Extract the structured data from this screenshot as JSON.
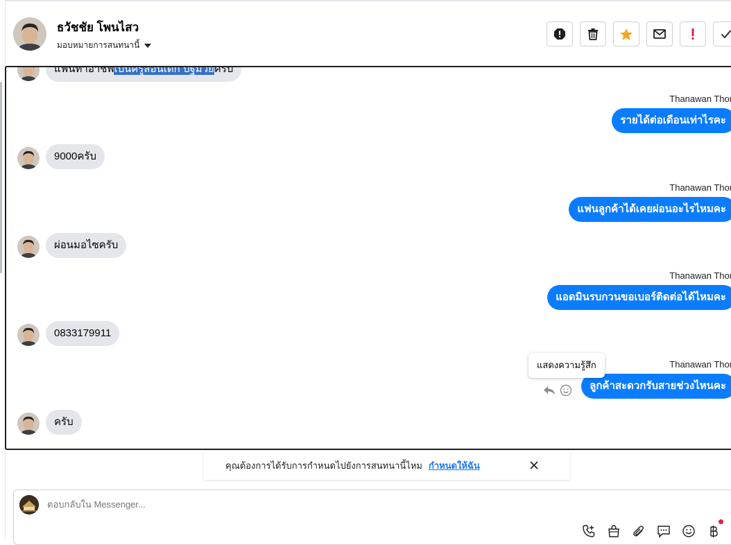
{
  "contact": {
    "name": "ธวัชชัย โพนไสว",
    "assign_label": "มอบหมายการสนทนานี้"
  },
  "header_actions": [
    "spam-icon",
    "trash-icon",
    "star-icon",
    "mail-icon",
    "important-icon",
    "done-icon"
  ],
  "messages": {
    "m0": {
      "text_before": "แฟนทำอาชีพ",
      "text_highlight": "เป็นครูสอนเด็ก ปฐมวัย",
      "text_after": "ครับ"
    },
    "out1": {
      "sender": "Thanawan Thon",
      "text": "รายได้ต่อเดือนเท่าไรคะ"
    },
    "in1": {
      "text": "9000ครับ"
    },
    "out2": {
      "sender": "Thanawan Thon",
      "text": "แฟนลูกค้าได้เคยผ่อนอะไรไหมคะ"
    },
    "in2": {
      "text": "ผ่อนมอไซครับ"
    },
    "out3": {
      "sender": "Thanawan Thon",
      "text": "แอดมินรบกวนขอเบอร์ติดต่อได้ไหมคะ"
    },
    "in3": {
      "text": "0833179911"
    },
    "out4": {
      "sender": "Thanawan Thon",
      "text": "ลูกค้าสะดวกรับสายช่วงไหนคะ"
    },
    "in4": {
      "text": "ครับ"
    }
  },
  "tooltip": "แสดงความรู้สึก",
  "notice": {
    "text": "คุณต้องการได้รับการกำหนดไปยังการสนทนานี้ไหม",
    "link": "กำหนดให้ฉัน"
  },
  "composer": {
    "placeholder": "ตอบกลับใน Messenger...",
    "tools": [
      "call-add-icon",
      "shopping-bag-icon",
      "attachment-icon",
      "saved-reply-icon",
      "emoji-icon",
      "baht-icon"
    ]
  },
  "colors": {
    "outgoing_bubble": "#0a7cff",
    "incoming_bubble": "#e4e6eb",
    "highlight": "#3470c9",
    "link": "#1877f2",
    "star": "#f5a623",
    "important": "#e41e3f"
  }
}
